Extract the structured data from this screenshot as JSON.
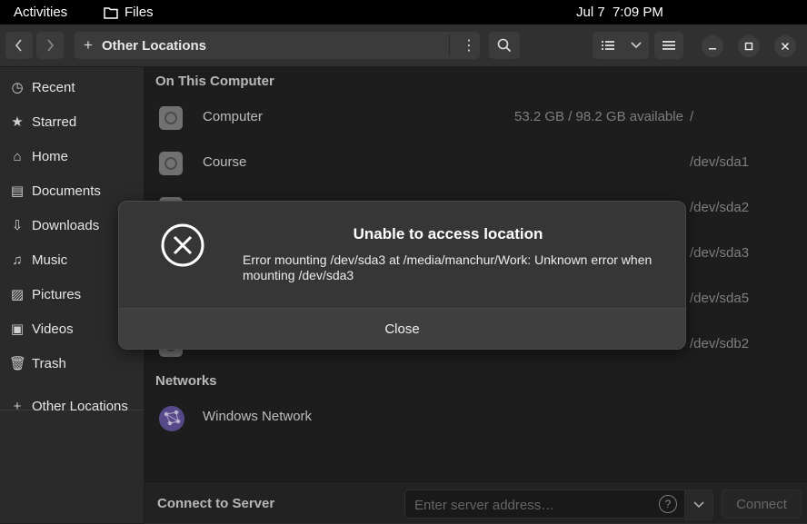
{
  "topbar": {
    "activities": "Activities",
    "app_name": "Files",
    "clock": "Jul 7  7:09 PM"
  },
  "headerbar": {
    "back_icon": "chevron-left-icon",
    "forward_icon": "chevron-right-icon",
    "path_title": "Other Locations",
    "path_icon": "plus-icon",
    "menu_icon": "kebab-icon",
    "search_icon": "search-icon",
    "view_icon": "list-view-icon",
    "view_dropdown_icon": "chevron-down-icon",
    "hamburger_icon": "hamburger-icon",
    "minimize_icon": "minimize-icon",
    "maximize_icon": "maximize-icon",
    "close_icon": "close-icon"
  },
  "sidebar": {
    "items": [
      {
        "label": "Recent",
        "icon": "clock-icon"
      },
      {
        "label": "Starred",
        "icon": "star-icon"
      },
      {
        "label": "Home",
        "icon": "home-icon"
      },
      {
        "label": "Documents",
        "icon": "document-icon"
      },
      {
        "label": "Downloads",
        "icon": "download-icon"
      },
      {
        "label": "Music",
        "icon": "music-icon"
      },
      {
        "label": "Pictures",
        "icon": "picture-icon"
      },
      {
        "label": "Videos",
        "icon": "video-icon"
      },
      {
        "label": "Trash",
        "icon": "trash-icon"
      },
      {
        "label": "Other Locations",
        "icon": "plus-icon"
      }
    ]
  },
  "main": {
    "section_computer": "On This Computer",
    "rows": [
      {
        "name": "Computer",
        "available": "53.2 GB / 98.2 GB available",
        "device": "/"
      },
      {
        "name": "Course",
        "available": "",
        "device": "/dev/sda1"
      },
      {
        "name": "",
        "available": "",
        "device": "/dev/sda2"
      },
      {
        "name": "",
        "available": "",
        "device": "/dev/sda3"
      },
      {
        "name": "",
        "available": "",
        "device": "/dev/sda5"
      },
      {
        "name": "",
        "available": "",
        "device": "/dev/sdb2"
      }
    ],
    "section_networks": "Networks",
    "network_row": {
      "name": "Windows Network",
      "icon": "network-globe-icon"
    }
  },
  "footer": {
    "label": "Connect to Server",
    "placeholder": "Enter server address…",
    "help_icon": "help-icon",
    "dropdown_icon": "chevron-down-icon",
    "connect_label": "Connect"
  },
  "dialog": {
    "icon": "error-circle-x-icon",
    "title": "Unable to access location",
    "message": "Error mounting /dev/sda3 at /media/manchur/Work: Unknown error when mounting /dev/sda3",
    "button": "Close"
  }
}
